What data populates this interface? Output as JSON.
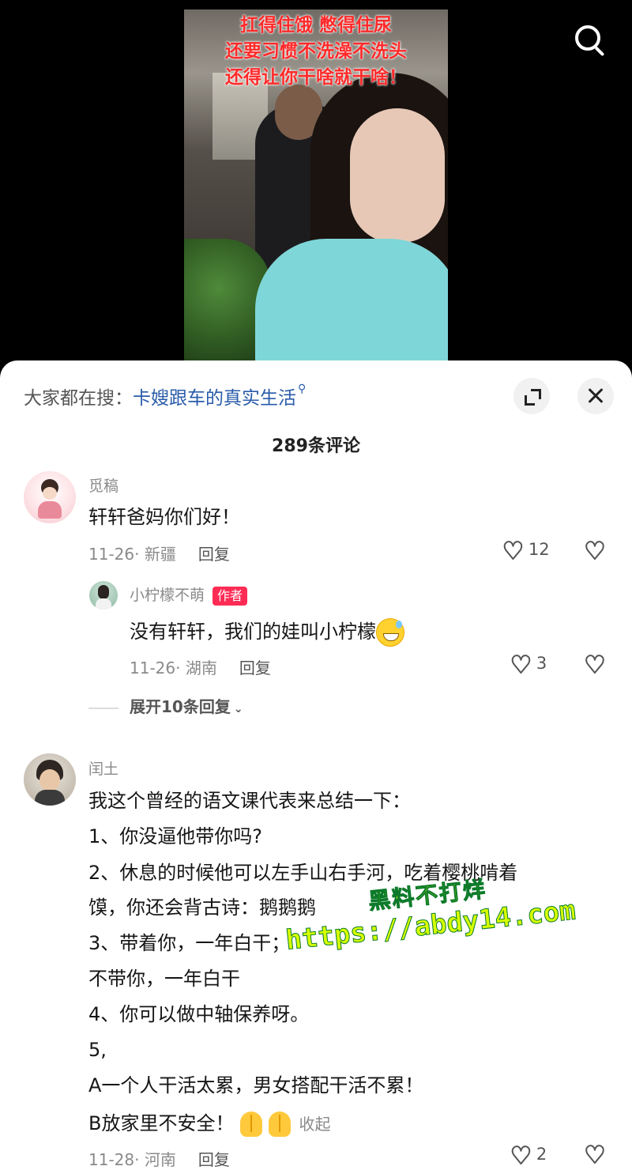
{
  "video": {
    "caption": "扛得住饿 憋得住尿\n还要习惯不洗澡不洗头\n还得让你干啥就干啥！"
  },
  "panel": {
    "search_prefix": "大家都在搜：",
    "search_query": "卡嫂跟车的真实生活",
    "comment_count": "289条评论"
  },
  "comments": [
    {
      "username": "觅稿",
      "text": "轩轩爸妈你们好！",
      "date_location": "11-26· 新疆",
      "reply_label": "回复",
      "likes": "12",
      "replies": [
        {
          "username": "小柠檬不萌",
          "badge": "作者",
          "text": "没有轩轩，我们的娃叫小柠檬",
          "date_location": "11-26· 湖南",
          "reply_label": "回复",
          "likes": "3"
        }
      ],
      "expand_label": "展开10条回复"
    },
    {
      "username": "闰土",
      "lines": [
        "我这个曾经的语文课代表来总结一下：",
        "1、你没逼他带你吗?",
        "2、休息的时候他可以左手山右手河，吃着樱桃啃着",
        "馍，你还会背古诗：鹅鹅鹅",
        "3、带着你，一年白干；",
        "不带你，一年白干",
        "4、你可以做中轴保养呀。",
        "5,",
        "A一个人干活太累，男女搭配干活不累！",
        "B放家里不安全！"
      ],
      "collapse_label": "收起",
      "date_location": "11-28· 河南",
      "reply_label": "回复",
      "likes": "2"
    }
  ],
  "watermark": {
    "line1": "黑料不打烊",
    "line2": "https://abdy14.com"
  },
  "colors": {
    "accent_red": "#fe2c55",
    "link_blue": "#2a5caa",
    "caption_red": "#ff2a2a"
  },
  "icons": [
    "search-icon",
    "expand-icon",
    "close-icon",
    "heart-icon",
    "dislike-icon",
    "chevron-down-icon"
  ]
}
